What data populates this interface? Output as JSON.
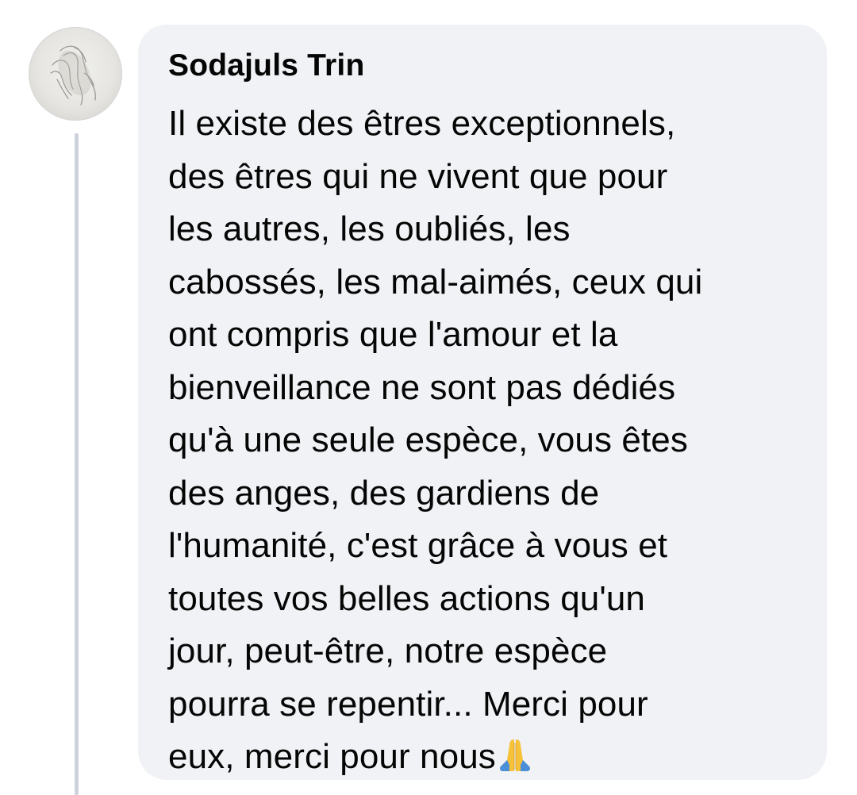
{
  "comment": {
    "author": "Sodajuls Trin",
    "avatar_icon": "praying-hands-sketch-icon",
    "text_lines": [
      "Il existe des êtres exceptionnels,",
      "des êtres qui ne vivent que pour",
      "les autres, les oubliés, les",
      "cabossés, les mal-aimés, ceux qui",
      "ont compris que l'amour et la",
      "bienveillance ne sont pas dédiés",
      "qu'à une seule espèce, vous êtes",
      "des anges, des gardiens de",
      "l'humanité, c'est grâce à vous et",
      "toutes vos belles actions qu'un",
      "jour, peut-être, notre espèce",
      "pourra se repentir... Merci pour",
      "eux, merci pour nous"
    ],
    "trailing_emoji": "folded-hands-emoji-icon",
    "colors": {
      "bubble_background": "#f0f2f5",
      "text": "#050505",
      "thread_line": "#ced3db",
      "emoji_blue": "#4a8fd8",
      "emoji_yellow": "#f6c23a"
    }
  }
}
